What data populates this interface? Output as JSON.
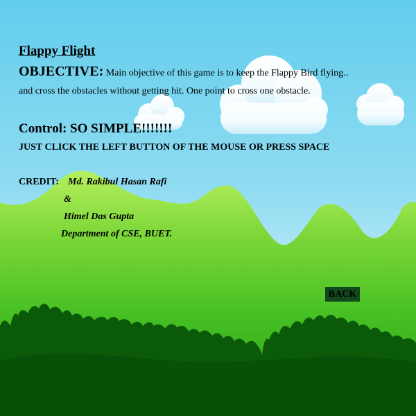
{
  "game": {
    "title": "Flappy Flight"
  },
  "objective": {
    "heading": "OBJECTIVE:",
    "text_line1": " Main objective of this game is to keep the Flappy Bird flying..",
    "text_line2": "and cross the obstacles without getting hit. One point to cross one obstacle."
  },
  "control": {
    "heading": "Control: SO SIMPLE!!!!!!!",
    "instruction": "JUST CLICK THE LEFT BUTTON OF THE MOUSE OR PRESS SPACE"
  },
  "credit": {
    "label": "CREDIT:",
    "author1": "Md. Rakibul Hasan Rafi",
    "ampersand": "&",
    "author2": "Himel Das Gupta",
    "department": "Department of CSE, BUET."
  },
  "buttons": {
    "back_label": "BACK"
  },
  "colors": {
    "sky_top": "#62cdec",
    "sky_bottom": "#e8f8fb",
    "hill_light": "#9fe84a",
    "hill_mid": "#3cb81c",
    "forest_dark": "#0a5a0a",
    "back_button_bg": "#11481c"
  }
}
